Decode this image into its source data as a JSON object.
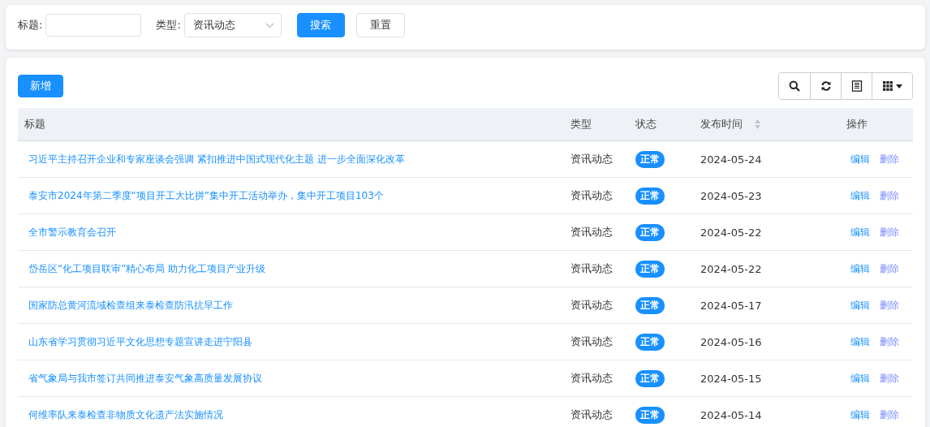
{
  "filters": {
    "title_label": "标题:",
    "type_label": "类型:",
    "type_value": "资讯动态",
    "search_button": "搜索",
    "reset_button": "重置"
  },
  "toolbar": {
    "add_button": "新增",
    "tools": [
      {
        "kind": "search"
      },
      {
        "kind": "refresh"
      },
      {
        "kind": "list"
      },
      {
        "kind": "columns"
      }
    ]
  },
  "table": {
    "columns": [
      {
        "label": "标题",
        "sortable": false
      },
      {
        "label": "类型",
        "sortable": false
      },
      {
        "label": "状态",
        "sortable": false
      },
      {
        "label": "发布时间",
        "sortable": true
      },
      {
        "label": "操作",
        "sortable": false
      }
    ],
    "rows": [
      {
        "title": "习近平主持召开企业和专家座谈会强调 紧扣推进中国式现代化主题 进一步全面深化改革",
        "type": "资讯动态",
        "status": "正常",
        "date": "2024-05-24",
        "actions": [
          "编辑",
          "删除"
        ]
      },
      {
        "title": "泰安市2024年第二季度“项目开工大比拼”集中开工活动举办，集中开工项目103个",
        "type": "资讯动态",
        "status": "正常",
        "date": "2024-05-23",
        "actions": [
          "编辑",
          "删除"
        ]
      },
      {
        "title": "全市警示教育会召开",
        "type": "资讯动态",
        "status": "正常",
        "date": "2024-05-22",
        "actions": [
          "编辑",
          "删除"
        ]
      },
      {
        "title": "岱岳区“化工项目联审”精心布局 助力化工项目产业升级",
        "type": "资讯动态",
        "status": "正常",
        "date": "2024-05-22",
        "actions": [
          "编辑",
          "删除"
        ]
      },
      {
        "title": "国家防总黄河流域检查组来泰检查防汛抗旱工作",
        "type": "资讯动态",
        "status": "正常",
        "date": "2024-05-17",
        "actions": [
          "编辑",
          "删除"
        ]
      },
      {
        "title": "山东省学习贯彻习近平文化思想专题宣讲走进宁阳县",
        "type": "资讯动态",
        "status": "正常",
        "date": "2024-05-16",
        "actions": [
          "编辑",
          "删除"
        ]
      },
      {
        "title": "省气象局与我市签订共同推进泰安气象高质量发展协议",
        "type": "资讯动态",
        "status": "正常",
        "date": "2024-05-15",
        "actions": [
          "编辑",
          "删除"
        ]
      },
      {
        "title": "何维率队来泰检查非物质文化遗产法实施情况",
        "type": "资讯动态",
        "status": "正常",
        "date": "2024-05-14",
        "actions": [
          "编辑",
          "删除"
        ]
      }
    ]
  }
}
